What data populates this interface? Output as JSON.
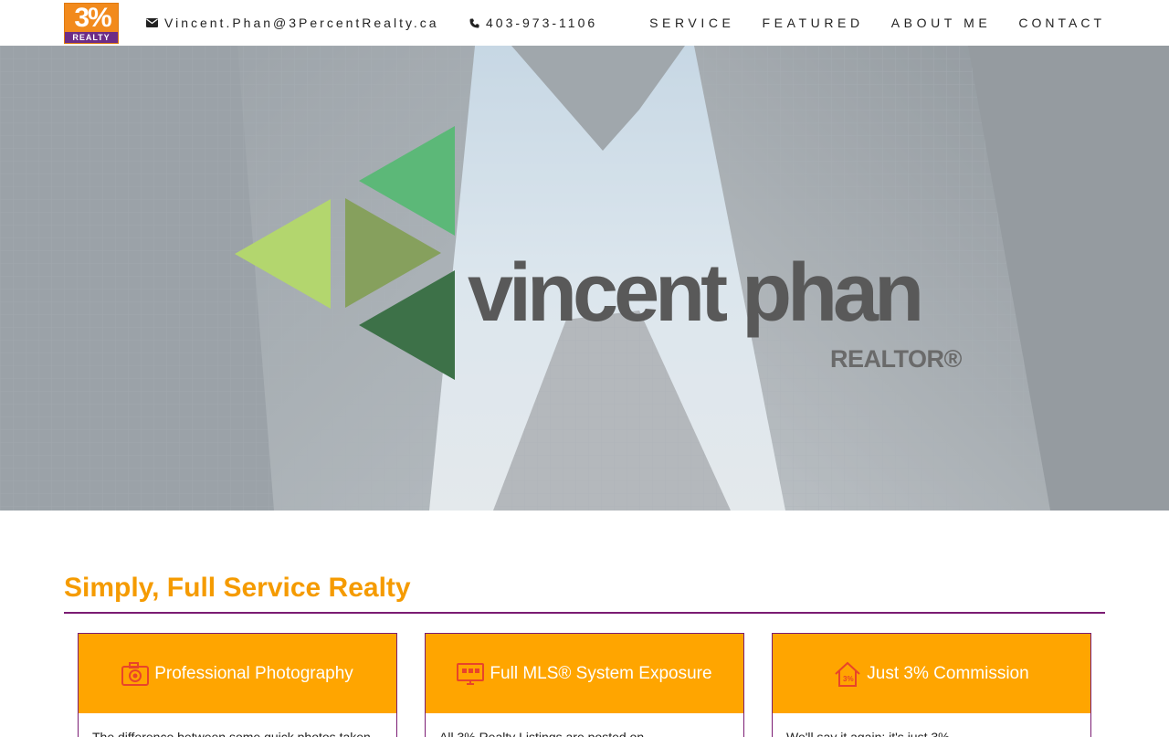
{
  "logo": {
    "number": "3%",
    "band": "REALTY"
  },
  "header": {
    "email": "Vincent.Phan@3PercentRealty.ca",
    "phone": "403-973-1106",
    "nav": [
      "SERVICE",
      "FEATURED",
      "ABOUT ME",
      "CONTACT"
    ]
  },
  "hero": {
    "name": "vincent phan",
    "subtitle": "REALTOR®"
  },
  "section": {
    "title": "Simply, Full Service Realty",
    "cards": [
      {
        "title": "Professional Photography",
        "text": "The difference between some quick photos taken",
        "icon": "camera-icon"
      },
      {
        "title": "Full MLS® System Exposure",
        "text": "All 3% Realty Listings are posted on",
        "icon": "monitor-icon"
      },
      {
        "title": "Just 3% Commission",
        "text": "We'll say it again; it's just 3%",
        "icon": "house-icon"
      }
    ]
  },
  "colors": {
    "accent": "#ffa500",
    "rule": "#7b1c73",
    "title": "#f59b00"
  }
}
